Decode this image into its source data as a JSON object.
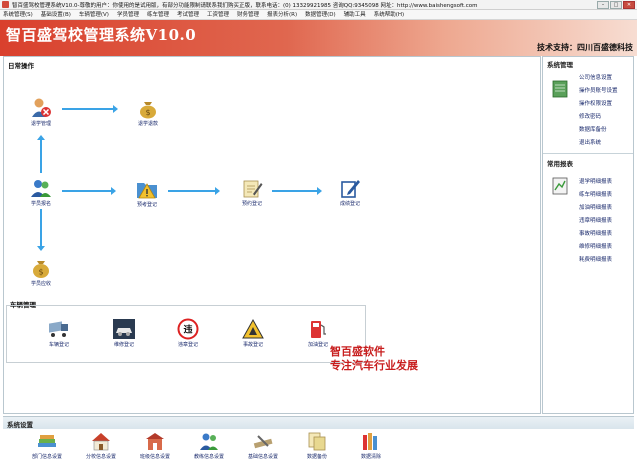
{
  "window": {
    "title": "智百盛驾校管理系统V10.0-尊敬的用户：你使用的是试用版，有部分功能限制请联系我们购买正版，联系电话：(0) 13329921985 咨询QQ:9345098 网址：http://www.baishengsoft.com",
    "buttons": {
      "min": "–",
      "max": "□",
      "close": "✕"
    }
  },
  "menu": [
    "系统管理(S)",
    "基础设置(B)",
    "车辆管理(V)",
    "学员管理",
    "练车管理",
    "考试管理",
    "工资管理",
    "财务管理",
    "报表分析(R)",
    "数据管理(D)",
    "辅助工具",
    "系统帮助(H)"
  ],
  "banner": {
    "title": "智百盛驾校管理系统V10.0",
    "support": "技术支持：四川百盛德科技"
  },
  "daily": {
    "title": "日常操作",
    "nodes": {
      "withdraw": "退学管理",
      "refund": "退学退款",
      "enroll": "学员报名",
      "preregister": "预考登记",
      "reserve": "预约登记",
      "score": "成绩登记",
      "fee": "学员应收"
    }
  },
  "vehicle": {
    "title": "车辆管理",
    "items": [
      "车辆登记",
      "维修登记",
      "违章登记",
      "事故登记",
      "加油登记"
    ]
  },
  "promo": {
    "line1": "智百盛软件",
    "line2": "专注汽车行业发展"
  },
  "system": {
    "title": "系统管理",
    "items": [
      "公司信息设置",
      "操作员账号设置",
      "操作权限设置",
      "修改密码",
      "数据库备份",
      "退出系统"
    ]
  },
  "reports": {
    "title": "常用报表",
    "items": [
      "退学明细报表",
      "练车明细报表",
      "加油明细报表",
      "违章明细报表",
      "事故明细报表",
      "维修明细报表",
      "耗费明细报表"
    ]
  },
  "settings": {
    "title": "系统设置",
    "items": [
      "部门信息设置",
      "分校信息设置",
      "班级信息设置",
      "教练信息设置",
      "基础信息设置",
      "数据备份",
      "数据清除"
    ]
  }
}
